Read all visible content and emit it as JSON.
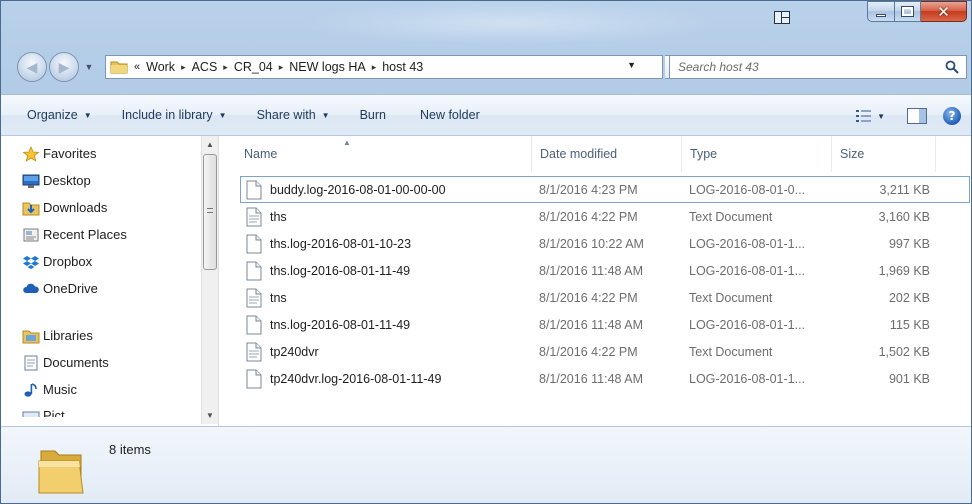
{
  "window": {
    "title": ""
  },
  "address": {
    "overflow": "«",
    "crumbs": [
      "Work",
      "ACS",
      "CR_04",
      "NEW logs HA",
      "host 43"
    ],
    "sep": "▸"
  },
  "search": {
    "placeholder": "Search host 43"
  },
  "toolbar": {
    "organize": "Organize",
    "include": "Include in library",
    "share": "Share with",
    "burn": "Burn",
    "new_folder": "New folder"
  },
  "nav": {
    "favorites": "Favorites",
    "desktop": "Desktop",
    "downloads": "Downloads",
    "recent": "Recent Places",
    "dropbox": "Dropbox",
    "onedrive": "OneDrive",
    "libraries": "Libraries",
    "documents": "Documents",
    "music": "Music",
    "pictures": "Pict..."
  },
  "columns": {
    "name": "Name",
    "date": "Date modified",
    "type": "Type",
    "size": "Size"
  },
  "files": [
    {
      "name": "buddy.log-2016-08-01-00-00-00",
      "date": "8/1/2016 4:23 PM",
      "type": "LOG-2016-08-01-0...",
      "size": "3,211 KB"
    },
    {
      "name": "ths",
      "date": "8/1/2016 4:22 PM",
      "type": "Text Document",
      "size": "3,160 KB"
    },
    {
      "name": "ths.log-2016-08-01-10-23",
      "date": "8/1/2016 10:22 AM",
      "type": "LOG-2016-08-01-1...",
      "size": "997 KB"
    },
    {
      "name": "ths.log-2016-08-01-11-49",
      "date": "8/1/2016 11:48 AM",
      "type": "LOG-2016-08-01-1...",
      "size": "1,969 KB"
    },
    {
      "name": "tns",
      "date": "8/1/2016 4:22 PM",
      "type": "Text Document",
      "size": "202 KB"
    },
    {
      "name": "tns.log-2016-08-01-11-49",
      "date": "8/1/2016 11:48 AM",
      "type": "LOG-2016-08-01-1...",
      "size": "115 KB"
    },
    {
      "name": "tp240dvr",
      "date": "8/1/2016 4:22 PM",
      "type": "Text Document",
      "size": "1,502 KB"
    },
    {
      "name": "tp240dvr.log-2016-08-01-11-49",
      "date": "8/1/2016 11:48 AM",
      "type": "LOG-2016-08-01-1...",
      "size": "901 KB"
    }
  ],
  "status": {
    "count": "8 items"
  },
  "colors": {
    "frame": "#a9c4e2",
    "toolbar_text": "#1e395b",
    "header_text": "#4c607a",
    "secondary_text": "#6d6d6d",
    "close_red": "#c43b1d"
  }
}
